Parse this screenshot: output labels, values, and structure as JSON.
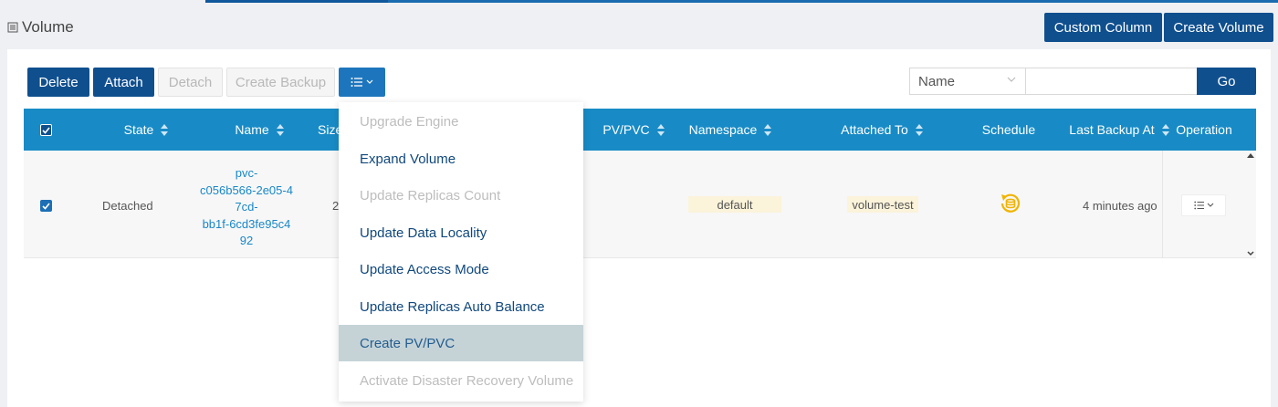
{
  "header": {
    "title": "Volume",
    "custom_column_label": "Custom Column",
    "create_volume_label": "Create Volume"
  },
  "toolbar": {
    "delete_label": "Delete",
    "attach_label": "Attach",
    "detach_label": "Detach",
    "create_backup_label": "Create Backup"
  },
  "search": {
    "field_selected": "Name",
    "value": "",
    "go_label": "Go"
  },
  "table": {
    "columns": [
      "State",
      "Name",
      "Size",
      "PV/PVC",
      "Namespace",
      "Attached To",
      "Schedule",
      "Last Backup At",
      "Operation"
    ],
    "rows": [
      {
        "state": "Detached",
        "name_lines": [
          "pvc-",
          "c056b566-2e05-4",
          "7cd-",
          "bb1f-6cd3fe95c4",
          "92"
        ],
        "size": "2",
        "namespace": "default",
        "attached_to": "volume-test",
        "last_backup_at": "4 minutes ago"
      }
    ]
  },
  "menu": {
    "items": [
      {
        "label": "Upgrade Engine",
        "state": "disabled"
      },
      {
        "label": "Expand Volume",
        "state": "enabled"
      },
      {
        "label": "Update Replicas Count",
        "state": "disabled"
      },
      {
        "label": "Update Data Locality",
        "state": "enabled"
      },
      {
        "label": "Update Access Mode",
        "state": "enabled"
      },
      {
        "label": "Update Replicas Auto Balance",
        "state": "enabled"
      },
      {
        "label": "Create PV/PVC",
        "state": "active"
      },
      {
        "label": "Activate Disaster Recovery Volume",
        "state": "disabled"
      }
    ]
  },
  "colors": {
    "primary": "#0f4f8e",
    "table_header": "#188bc6",
    "link": "#1887c9",
    "schedule_icon": "#f0b400",
    "menu_active": "#c5d3d7"
  }
}
